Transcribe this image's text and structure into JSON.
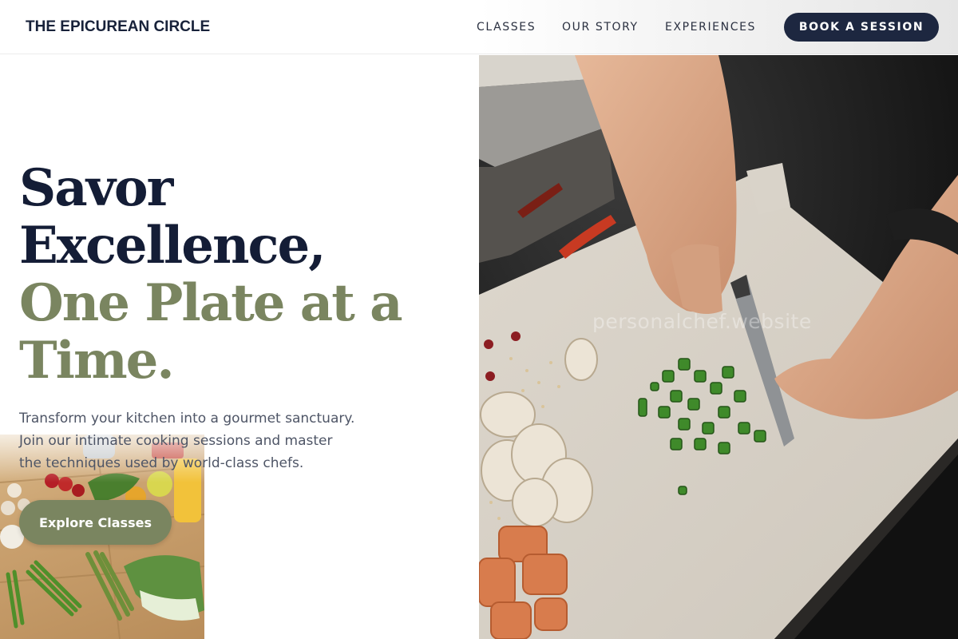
{
  "header": {
    "logo_text": "THE EPICUREAN CIRCLE",
    "nav": [
      "CLASSES",
      "OUR STORY",
      "EXPERIENCES"
    ],
    "cta_label": "BOOK A SESSION"
  },
  "hero": {
    "title_lines": [
      "Savor",
      "Excellence,"
    ],
    "title_accent_lines": [
      "One Plate at a",
      "Time."
    ],
    "subtitle_lines": [
      "Transform your kitchen into a gourmet sanctuary.",
      "Join our intimate cooking sessions and master",
      "the techniques used by world-class chefs."
    ],
    "button_label": "Explore Classes"
  },
  "images": {
    "watermark": "personalchef.website"
  },
  "colors": {
    "navy": "#1d2740",
    "olive": "#7a8560",
    "text_muted": "#4e5566"
  }
}
